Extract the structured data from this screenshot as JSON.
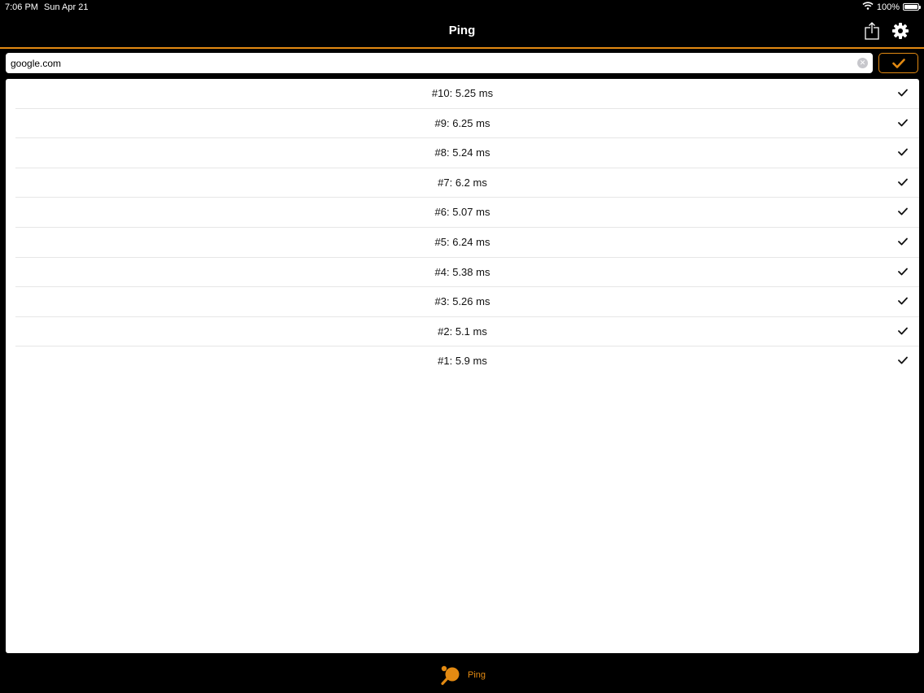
{
  "status_bar": {
    "time": "7:06 PM",
    "date": "Sun Apr 21",
    "battery_text": "100%",
    "battery_level": 1.0
  },
  "nav": {
    "title": "Ping",
    "share_icon": "share-icon",
    "settings_icon": "gear-icon"
  },
  "search": {
    "value": "google.com",
    "clear_icon": "clear-icon",
    "go_icon": "checkmark-icon"
  },
  "results": [
    {
      "label": "#10: 5.25 ms",
      "status_icon": "checkmark-icon"
    },
    {
      "label": "#9: 6.25 ms",
      "status_icon": "checkmark-icon"
    },
    {
      "label": "#8: 5.24 ms",
      "status_icon": "checkmark-icon"
    },
    {
      "label": "#7: 6.2 ms",
      "status_icon": "checkmark-icon"
    },
    {
      "label": "#6: 5.07 ms",
      "status_icon": "checkmark-icon"
    },
    {
      "label": "#5: 6.24 ms",
      "status_icon": "checkmark-icon"
    },
    {
      "label": "#4: 5.38 ms",
      "status_icon": "checkmark-icon"
    },
    {
      "label": "#3: 5.26 ms",
      "status_icon": "checkmark-icon"
    },
    {
      "label": "#2: 5.1 ms",
      "status_icon": "checkmark-icon"
    },
    {
      "label": "#1: 5.9 ms",
      "status_icon": "checkmark-icon"
    }
  ],
  "tab_bar": {
    "items": [
      {
        "label": "Ping",
        "icon": "ping-pong-icon",
        "selected": true
      }
    ]
  },
  "colors": {
    "accent": "#e38a12",
    "background": "#000000",
    "panel": "#ffffff"
  }
}
